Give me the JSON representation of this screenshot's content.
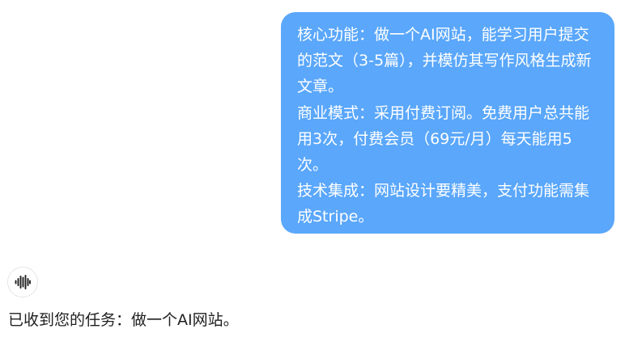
{
  "conversation": {
    "user_message": {
      "paragraphs": [
        "核心功能：做一个AI网站，能学习用户提交的范文（3-5篇），并模仿其写作风格生成新文章。",
        "商业模式：采用付费订阅。免费用户总共能用3次，付费会员（69元/月）每天能用5次。",
        "技术集成：网站设计要精美，支付功能需集成Stripe。"
      ]
    },
    "assistant_message": {
      "avatar_icon": "waveform-icon",
      "text": "已收到您的任务：做一个AI网站。"
    }
  },
  "colors": {
    "user_bubble_bg": "#5aa7fb",
    "user_bubble_text": "#ffffff",
    "assistant_text": "#1f1f1f",
    "avatar_border": "#e3e5e8"
  }
}
